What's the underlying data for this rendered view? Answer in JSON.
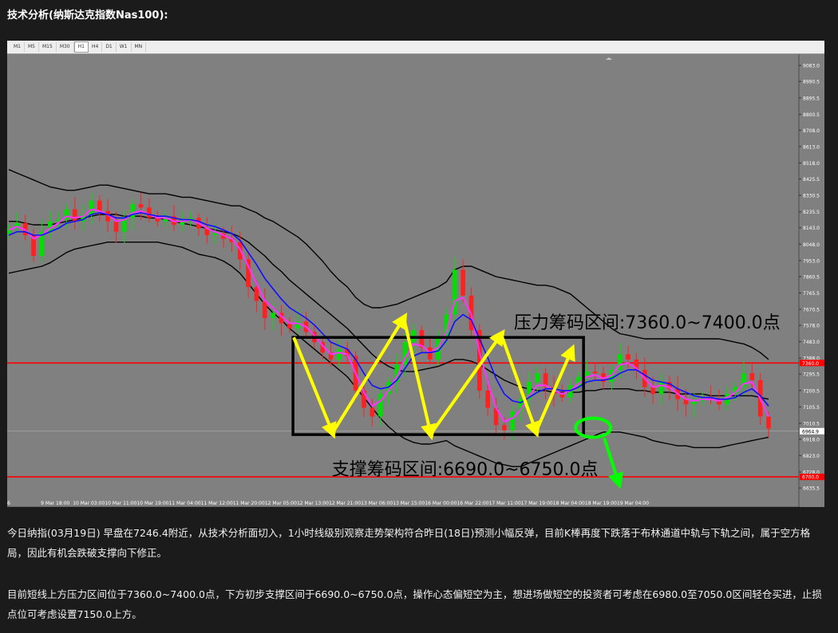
{
  "heading": "技术分析(纳斯达克指数Nas100):",
  "timeframes": [
    "M1",
    "M5",
    "M15",
    "M30",
    "H1",
    "H4",
    "D1",
    "W1",
    "MN"
  ],
  "active_timeframe": "H1",
  "paragraphs": [
    "今日纳指(03月19日) 早盘在7246.4附近，从技术分析面切入，1小时线级别观察走势架构符合昨日(18日)预测小幅反弹，目前K棒再度下跌落于布林通道中轨与下轨之间，属于空方格局，因此有机会跌破支撑向下修正。",
    "目前短线上方压力区间位于7360.0~7400.0点，下方初步支撑区间于6690.0~6750.0点，操作心态偏短空为主，想进场做短空的投资者可考虑在6980.0至7050.0区间轻仓买进，止损点位可考虑设置7150.0上方。"
  ],
  "chart_data": {
    "type": "candlestick",
    "timeframe": "H1",
    "ylim": [
      6590,
      9130
    ],
    "y_ticks": [
      "9083.0",
      "8990.5",
      "8895.5",
      "8800.5",
      "8708.0",
      "8613.0",
      "8518.0",
      "8425.5",
      "8330.5",
      "8235.5",
      "8143.0",
      "8048.0",
      "7953.0",
      "7860.5",
      "7765.5",
      "7670.5",
      "7578.0",
      "7483.0",
      "7388.0",
      "7295.5",
      "7200.5",
      "7105.5",
      "7010.5",
      "6918.0",
      "6823.0",
      "6728.0",
      "6635.5"
    ],
    "x_ticks": [
      "6",
      "9 Mar 18:00",
      "10 Mar 03:00",
      "10 Mar 11:00",
      "10 Mar 19:00",
      "11 Mar 04:00",
      "11 Mar 12:00",
      "11 Mar 20:00",
      "12 Mar 05:00",
      "12 Mar 13:00",
      "12 Mar 21:00",
      "13 Mar 06:00",
      "13 Mar 15:00",
      "16 Mar 00:00",
      "16 Mar 22:00",
      "17 Mar 11:00",
      "17 Mar 19:00",
      "18 Mar 04:00",
      "18 Mar 19:00",
      "19 Mar 04:00"
    ],
    "price_labels": {
      "current": "6964.9",
      "red_upper": "7360.0",
      "red_lower": "6700.0"
    },
    "horizontal_lines": [
      {
        "price": 7360,
        "color": "#ff0000"
      },
      {
        "price": 6700,
        "color": "#ff0000"
      }
    ],
    "current_price": 6964.9,
    "box": {
      "x_from": 0.361,
      "x_to": 0.728,
      "price_top": 7508,
      "price_bottom": 6945
    },
    "annotations": {
      "resistance": "压力筹码区间:7360.0~7400.0点",
      "support": "支撑筹码区间:6690.0~6750.0点"
    },
    "zigzag": [
      {
        "x": 0.362,
        "price": 7508
      },
      {
        "x": 0.411,
        "price": 6955
      },
      {
        "x": 0.501,
        "price": 7620
      },
      {
        "x": 0.535,
        "price": 6948
      },
      {
        "x": 0.624,
        "price": 7525
      },
      {
        "x": 0.668,
        "price": 6962
      },
      {
        "x": 0.713,
        "price": 7435
      }
    ],
    "colors": {
      "background": "#808080",
      "bull": "#00e000",
      "bear": "#ff2020",
      "bb_band": "#000000",
      "ma_fast": "#ff33ff",
      "ma_slow": "#1010ff",
      "box": "#000000",
      "zigzag": "#ffff00",
      "signal": "#00ff00",
      "hline": "#ff0000"
    },
    "series": [
      {
        "name": "",
        "role": "candles",
        "close": [
          8140,
          8170,
          8100,
          7980,
          8120,
          8180,
          8190,
          8250,
          8180,
          8220,
          8300,
          8240,
          8180,
          8120,
          8200,
          8280,
          8260,
          8200,
          8180,
          8210,
          8160,
          8190,
          8200,
          8140,
          8100,
          8110,
          8080,
          8060,
          7960,
          7800,
          7720,
          7620,
          7650,
          7590,
          7560,
          7600,
          7540,
          7480,
          7420,
          7380,
          7440,
          7400,
          7200,
          7100,
          7050,
          7180,
          7250,
          7350,
          7480,
          7550,
          7450,
          7380,
          7500,
          7640,
          7900,
          7750,
          7550,
          7200,
          7100,
          7000,
          6970,
          7080,
          7150,
          7250,
          7300,
          7220,
          7180,
          7160,
          7230,
          7280,
          7310,
          7300,
          7250,
          7320,
          7410,
          7380,
          7320,
          7220,
          7180,
          7250,
          7210,
          7150,
          7120,
          7140,
          7160,
          7150,
          7120,
          7180,
          7220,
          7300,
          7260,
          7050,
          6980
        ]
      },
      {
        "name": "",
        "role": "bollinger-upper",
        "values": [
          8480,
          8460,
          8440,
          8420,
          8400,
          8380,
          8370,
          8360,
          8360,
          8370,
          8380,
          8390,
          8390,
          8380,
          8370,
          8360,
          8350,
          8340,
          8340,
          8340,
          8330,
          8320,
          8320,
          8310,
          8300,
          8290,
          8280,
          8270,
          8270,
          8250,
          8230,
          8200,
          8180,
          8150,
          8120,
          8090,
          8050,
          8000,
          7950,
          7890,
          7840,
          7800,
          7740,
          7700,
          7680,
          7680,
          7690,
          7700,
          7720,
          7740,
          7760,
          7780,
          7800,
          7830,
          7900,
          7920,
          7920,
          7900,
          7880,
          7860,
          7850,
          7840,
          7830,
          7820,
          7810,
          7810,
          7800,
          7780,
          7760,
          7720,
          7680,
          7640,
          7600,
          7560,
          7530,
          7520,
          7510,
          7500,
          7500,
          7500,
          7500,
          7500,
          7500,
          7500,
          7500,
          7500,
          7500,
          7490,
          7480,
          7470,
          7450,
          7420,
          7380
        ]
      },
      {
        "name": "",
        "role": "bollinger-middle",
        "values": [
          8180,
          8180,
          8170,
          8160,
          8160,
          8160,
          8170,
          8180,
          8190,
          8200,
          8210,
          8220,
          8220,
          8220,
          8210,
          8210,
          8210,
          8200,
          8200,
          8190,
          8180,
          8170,
          8160,
          8150,
          8140,
          8130,
          8120,
          8110,
          8090,
          8060,
          8020,
          7980,
          7930,
          7890,
          7840,
          7800,
          7760,
          7720,
          7680,
          7640,
          7600,
          7560,
          7510,
          7460,
          7410,
          7370,
          7340,
          7320,
          7310,
          7310,
          7320,
          7330,
          7340,
          7360,
          7380,
          7380,
          7370,
          7350,
          7320,
          7290,
          7260,
          7240,
          7220,
          7210,
          7200,
          7200,
          7190,
          7190,
          7190,
          7190,
          7200,
          7200,
          7210,
          7210,
          7210,
          7210,
          7200,
          7200,
          7190,
          7190,
          7190,
          7180,
          7180,
          7180,
          7180,
          7170,
          7170,
          7170,
          7170,
          7170,
          7170,
          7160,
          7150
        ]
      },
      {
        "name": "",
        "role": "bollinger-lower",
        "values": [
          7880,
          7890,
          7900,
          7910,
          7920,
          7940,
          7970,
          8000,
          8020,
          8030,
          8040,
          8050,
          8060,
          8060,
          8060,
          8060,
          8060,
          8060,
          8060,
          8050,
          8040,
          8030,
          8010,
          7990,
          7980,
          7970,
          7950,
          7920,
          7880,
          7820,
          7760,
          7700,
          7650,
          7610,
          7560,
          7520,
          7480,
          7440,
          7400,
          7360,
          7320,
          7280,
          7220,
          7160,
          7100,
          7040,
          6990,
          6950,
          6920,
          6900,
          6890,
          6890,
          6900,
          6910,
          6880,
          6860,
          6840,
          6820,
          6800,
          6780,
          6770,
          6760,
          6760,
          6780,
          6800,
          6820,
          6840,
          6860,
          6880,
          6900,
          6920,
          6940,
          6960,
          6960,
          6960,
          6950,
          6940,
          6930,
          6910,
          6900,
          6890,
          6880,
          6880,
          6870,
          6870,
          6870,
          6870,
          6880,
          6890,
          6900,
          6910,
          6920,
          6930
        ]
      },
      {
        "name": "",
        "role": "ma-fast",
        "values": [
          8130,
          8150,
          8130,
          8080,
          8100,
          8140,
          8170,
          8210,
          8200,
          8210,
          8250,
          8240,
          8220,
          8180,
          8190,
          8230,
          8240,
          8220,
          8200,
          8200,
          8180,
          8180,
          8190,
          8170,
          8140,
          8120,
          8100,
          8080,
          8020,
          7920,
          7820,
          7720,
          7680,
          7630,
          7590,
          7590,
          7570,
          7520,
          7460,
          7410,
          7420,
          7410,
          7300,
          7190,
          7110,
          7140,
          7200,
          7280,
          7390,
          7470,
          7460,
          7420,
          7450,
          7540,
          7720,
          7740,
          7640,
          7420,
          7250,
          7100,
          7020,
          7040,
          7090,
          7170,
          7230,
          7230,
          7200,
          7180,
          7200,
          7240,
          7280,
          7290,
          7270,
          7290,
          7350,
          7360,
          7330,
          7270,
          7220,
          7230,
          7220,
          7180,
          7150,
          7140,
          7150,
          7150,
          7140,
          7160,
          7190,
          7240,
          7250,
          7150,
          7050
        ]
      },
      {
        "name": "",
        "role": "ma-slow",
        "values": [
          8100,
          8120,
          8120,
          8100,
          8100,
          8120,
          8140,
          8170,
          8180,
          8190,
          8220,
          8230,
          8220,
          8200,
          8200,
          8220,
          8230,
          8220,
          8210,
          8210,
          8200,
          8190,
          8190,
          8180,
          8160,
          8150,
          8130,
          8110,
          8070,
          8000,
          7930,
          7850,
          7790,
          7730,
          7680,
          7650,
          7620,
          7580,
          7530,
          7480,
          7460,
          7440,
          7380,
          7300,
          7230,
          7210,
          7220,
          7260,
          7330,
          7400,
          7420,
          7420,
          7430,
          7490,
          7600,
          7640,
          7610,
          7500,
          7390,
          7270,
          7180,
          7140,
          7130,
          7160,
          7190,
          7210,
          7210,
          7200,
          7200,
          7220,
          7250,
          7260,
          7260,
          7270,
          7300,
          7320,
          7320,
          7290,
          7260,
          7250,
          7240,
          7210,
          7190,
          7170,
          7160,
          7160,
          7150,
          7150,
          7160,
          7190,
          7210,
          7170,
          7110
        ]
      }
    ]
  }
}
